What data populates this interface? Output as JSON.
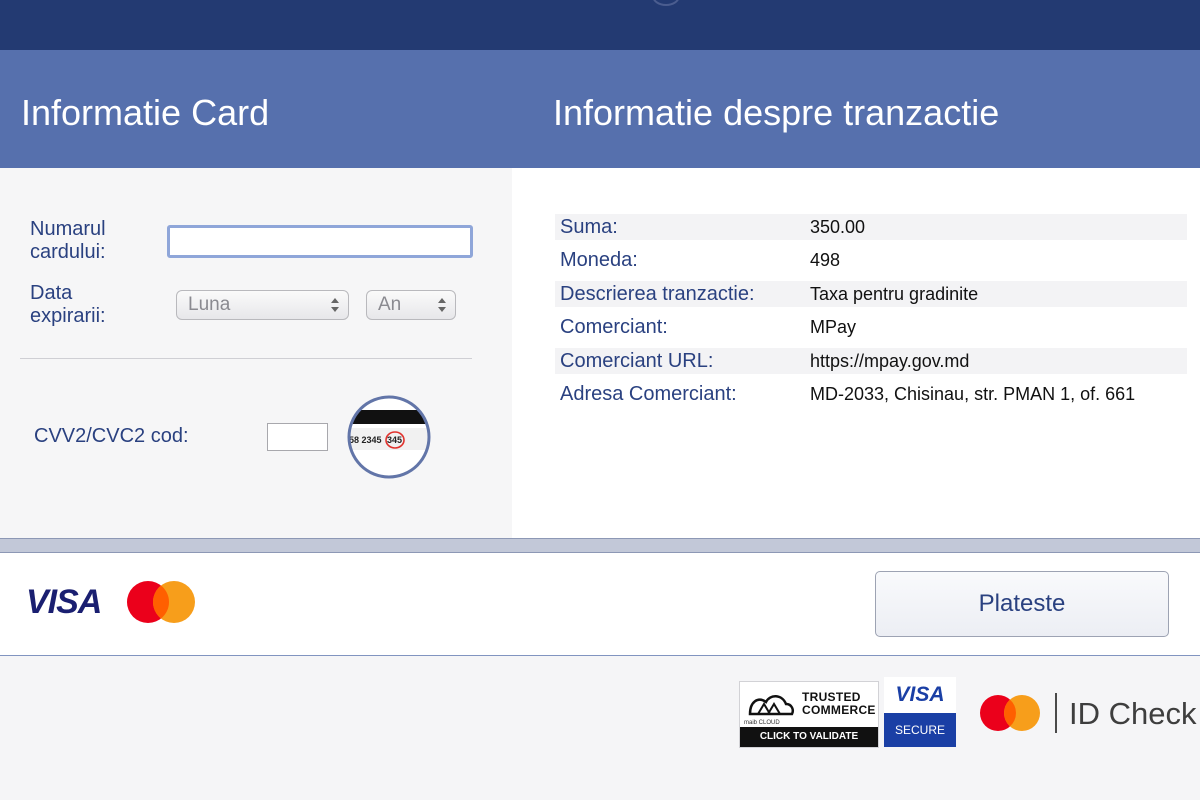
{
  "header": {
    "card_section_title": "Informatie Card",
    "transaction_section_title": "Informatie despre tranzactie"
  },
  "card_form": {
    "card_number_label": "Numarul cardului:",
    "card_number_value": "",
    "expiry_label": "Data expirarii:",
    "month_select": "Luna",
    "year_select": "An",
    "cvv_label": "CVV2/CVC2 cod:",
    "cvv_value": "",
    "cvv_hint_text": "58 2345",
    "cvv_hint_code": "345"
  },
  "transaction": {
    "rows": [
      {
        "label": "Suma:",
        "value": "350.00"
      },
      {
        "label": "Moneda:",
        "value": "498"
      },
      {
        "label": "Descrierea tranzactie:",
        "value": "Taxa pentru gradinite"
      },
      {
        "label": "Comerciant:",
        "value": "MPay"
      },
      {
        "label": "Comerciant URL:",
        "value": "https://mpay.gov.md"
      },
      {
        "label": "Adresa Comerciant:",
        "value": "MD-2033, Chisinau, str. PMAN 1, of. 661"
      }
    ]
  },
  "footer": {
    "visa_logo_text": "VISA",
    "pay_button_label": "Plateste"
  },
  "badges": {
    "trusted_line1": "TRUSTED",
    "trusted_line2": "COMMERCE",
    "trusted_brand": "maib CLOUD",
    "trusted_cta": "CLICK TO VALIDATE",
    "visa_secure_top": "VISA",
    "visa_secure_bottom": "SECURE",
    "id_check_text": "ID Check"
  },
  "colors": {
    "top_bar": "#233a72",
    "header_band": "#5670ad",
    "label_text": "#2a4180",
    "visa_blue": "#1a1f71",
    "mastercard_red": "#eb001b",
    "mastercard_orange": "#f79e1b"
  },
  "icons": {
    "mastercard": "mastercard-logo-icon",
    "cvv_hint": "card-back-cvv-icon",
    "select_arrows": "select-arrows-icon"
  }
}
